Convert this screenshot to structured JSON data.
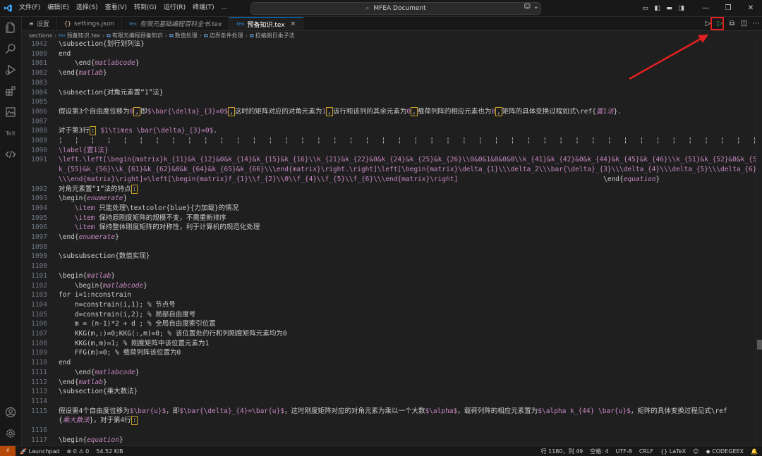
{
  "titlebar": {
    "menu": [
      "文件(F)",
      "编辑(E)",
      "选择(S)",
      "查看(V)",
      "转到(G)",
      "运行(R)",
      "终端(T)",
      "…"
    ],
    "search": "MFEA Document"
  },
  "tabs": [
    {
      "icon": "≡",
      "label": "设置"
    },
    {
      "icon": "{}",
      "label": "settings.json"
    },
    {
      "icon": "tex",
      "label": "有限元基础编程百科全书.tex"
    },
    {
      "icon": "tex",
      "label": "预备知识.tex"
    }
  ],
  "breadcrumb": [
    "sections",
    "预备知识.tex",
    "有限元编程预备知识",
    "数值处理",
    "边界条件处理",
    "拉格朗日乘子法"
  ],
  "editor": {
    "lines": [
      {
        "n": "1042",
        "html": "\\subsection{划行划列法}"
      },
      {
        "n": "1080",
        "html": "end"
      },
      {
        "n": "1081",
        "html": "    \\end{<span class='arg'>matlabcode</span>}"
      },
      {
        "n": "1082",
        "html": "\\end{<span class='arg'>matlab</span>}"
      },
      {
        "n": "1083",
        "html": ""
      },
      {
        "n": "1084",
        "html": "\\subsection{对角元素置“1”法}"
      },
      {
        "n": "1085",
        "html": ""
      },
      {
        "n": "1086",
        "html": "假设第3个自由度位移为<span class='math'>0</span><span class='box'>,</span>即<span class='math'>$\\bar{\\delta}_{3}=0$</span><span class='box'>,</span>这时的矩阵对应的对角元素为<span class='math'>1</span><span class='box'>,</span>该行和该列的其余元素为<span class='math'>0</span><span class='box'>,</span>载荷列阵的相应元素也为<span class='math'>0</span><span class='box'>,</span>矩阵的具体变换过程如式\\ref{<span class='arg'>置1法</span>}."
      },
      {
        "n": "1087",
        "html": ""
      },
      {
        "n": "1088",
        "html": "对于第3行<span class='box'>:</span> <span class='math'>$1\\times \\bar{\\delta}_{3}=0$</span>."
      },
      {
        "n": "1089",
        "html": "¦   ¦   ¦   ¦   ¦   ¦   ¦   ¦   ¦   ¦   ¦   ¦   ¦   ¦   ¦   ¦   ¦   ¦   ¦   ¦   ¦   ¦   ¦   ¦   ¦   ¦   ¦   ¦   ¦   ¦   ¦   ¦   ¦   ¦   ¦   ¦   ¦   ¦   ¦   ¦   ¦   ¦   ¦   ¦   ¦   ¦   \\begin{<span class='arg'>equation</span>}"
      },
      {
        "n": "1090",
        "html": "<span class='math'>\\label{置1法}</span>"
      },
      {
        "n": "1091",
        "html": "<span class='math'>\\left.\\left[\\begin{matrix}k_{11}&amp;k_{12}&amp;0&amp;k_{14}&amp;k_{15}&amp;k_{16}\\\\k_{21}&amp;k_{22}&amp;0&amp;k_{24}&amp;k_{25}&amp;k_{26}\\\\0&amp;0&amp;1&amp;0&amp;0&amp;0\\\\k_{41}&amp;k_{42}&amp;0&amp;k_{44}&amp;k_{45}&amp;k_{46}\\\\k_{51}&amp;k_{52}&amp;0&amp;k_{54}&amp;</span>"
      },
      {
        "n": "",
        "html": "<span class='math'>k_{55}&amp;k_{56}\\\\k_{61}&amp;k_{62}&amp;0&amp;k_{64}&amp;k_{65}&amp;k_{66}\\\\\\end{matrix}\\right.\\right]\\left[\\begin{matrix}\\delta_{1}\\\\\\delta_2\\\\\\bar{\\delta}_{3}\\\\\\delta_{4}\\\\\\delta_{5}\\\\\\delta_{6}</span>"
      },
      {
        "n": "",
        "html": "<span class='math'>\\\\\\end{matrix}\\right]=\\left[\\begin{matrix}f_{1}\\\\f_{2}\\\\0\\\\f_{4}\\\\f_{5}\\\\f_{6}\\\\\\end{matrix}\\right]</span>                                    \\end{<span class='arg'>equation</span>}"
      },
      {
        "n": "1092",
        "html": "对角元素置“1”法的特点<span class='box'>:</span>"
      },
      {
        "n": "1093",
        "html": "\\begin{<span class='arg'>enumerate</span>}"
      },
      {
        "n": "1094",
        "html": "    <span class='math'>\\item</span> 只能处理\\textcolor{blue}{力加载}的情况"
      },
      {
        "n": "1095",
        "html": "    <span class='math'>\\item</span> 保持原刚度矩阵的规模不变，不需重新排序"
      },
      {
        "n": "1096",
        "html": "    <span class='math'>\\item</span> 保持整体刚度矩阵的对称性，利于计算机的规范化处理"
      },
      {
        "n": "1097",
        "html": "\\end{<span class='arg'>enumerate</span>}"
      },
      {
        "n": "1098",
        "html": ""
      },
      {
        "n": "1099",
        "html": "\\subsubsection{数值实现}"
      },
      {
        "n": "1100",
        "html": ""
      },
      {
        "n": "1101",
        "html": "\\begin{<span class='arg'>matlab</span>}"
      },
      {
        "n": "1102",
        "html": "    \\begin{<span class='arg'>matlabcode</span>}"
      },
      {
        "n": "1103",
        "html": "for i=1:nconstrain"
      },
      {
        "n": "1104",
        "html": "    n=constrain(i,1); % 节点号"
      },
      {
        "n": "1105",
        "html": "    d=constrain(i,2); % 局部自由度号"
      },
      {
        "n": "1106",
        "html": "    m = (n-1)*2 + d ; % 全局自由度索引位置"
      },
      {
        "n": "1107",
        "html": "    KKG(m,:)=0;KKG(:,m)=0; % 该位置处的行和列刚度矩阵元素均为0"
      },
      {
        "n": "1108",
        "html": "    KKG(m,m)=1; % 刚度矩阵中该位置元素为1"
      },
      {
        "n": "1109",
        "html": "    FFG(m)=0; % 载荷列阵该位置为0"
      },
      {
        "n": "1110",
        "html": "end"
      },
      {
        "n": "1111",
        "html": "    \\end{<span class='arg'>matlabcode</span>}"
      },
      {
        "n": "1112",
        "html": "\\end{<span class='arg'>matlab</span>}"
      },
      {
        "n": "1113",
        "html": "\\subsection{乘大数法}"
      },
      {
        "n": "1114",
        "html": ""
      },
      {
        "n": "1115",
        "html": "假设第4个自由度位移为<span class='math'>$\\bar{u}$</span>，即<span class='math'>$\\bar{\\delta}_{4}=\\bar{u}$</span>，这时刚度矩阵对应的对角元素为乘以一个大数<span class='math'>$\\alpha$</span>，载荷列阵的相应元素置为<span class='math'>$\\alpha k_{44} \\bar{u}$</span>，矩阵的具体变换过程见式\\ref"
      },
      {
        "n": "",
        "html": "{<span class='arg'>乘大数法</span>}，对于第4行<span class='box'>:</span>"
      },
      {
        "n": "1116",
        "html": ""
      },
      {
        "n": "1117",
        "html": "\\begin{<span class='arg'>equation</span>}"
      }
    ]
  },
  "statusbar": {
    "launchpad": "Launchpad",
    "errors": "0",
    "warnings": "0",
    "size": "54.52 KiB",
    "cursor": "行 1180，列 49",
    "spaces": "空格: 4",
    "encoding": "UTF-8",
    "eol": "CRLF",
    "language": "LaTeX",
    "codegeex": "CODEGEEX"
  }
}
